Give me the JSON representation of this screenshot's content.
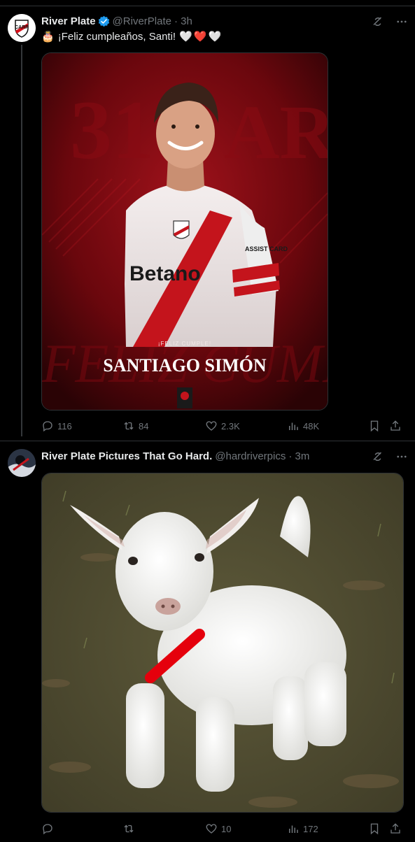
{
  "tweet1": {
    "author_name": "River Plate",
    "handle": "@RiverPlate",
    "time": "· 3h",
    "text": "¡Feliz cumpleaños, Santi!",
    "emoji_prefix": "🎂",
    "hearts": [
      "🤍",
      "❤️",
      "🤍"
    ],
    "image": {
      "small_text": "¡FELIZ CUMPLE!",
      "big_text": "SANTIAGO SIMÓN",
      "shirt_sponsor": "Betano",
      "sleeve_sponsor": "ASSIST CARD"
    },
    "actions": {
      "replies": "116",
      "reposts": "84",
      "likes": "2.3K",
      "views": "48K"
    }
  },
  "tweet2": {
    "author_name": "River Plate Pictures That Go Hard.",
    "handle": "@hardriverpics",
    "time": "· 3m",
    "actions": {
      "replies": "",
      "reposts": "",
      "likes": "10",
      "views": "172"
    }
  },
  "colors": {
    "background": "#000000",
    "text": "#e7e9ea",
    "muted": "#71767b",
    "verified": "#1d9bf0",
    "river_red": "#b5121b"
  }
}
